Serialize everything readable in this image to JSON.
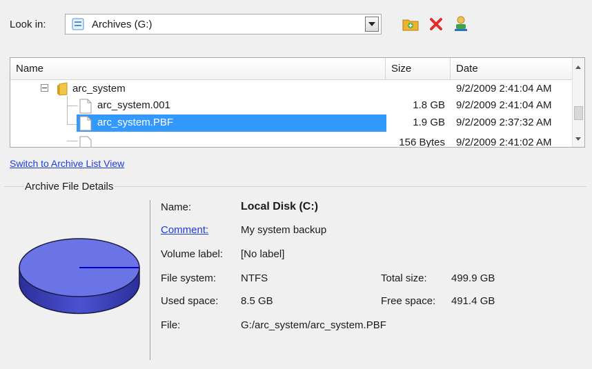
{
  "toolbar": {
    "look_in_label": "Look in:",
    "look_in_value": "Archives (G:)",
    "buttons": [
      "new-folder",
      "delete",
      "user"
    ]
  },
  "file_tree": {
    "columns": [
      "Name",
      "Size",
      "Date"
    ],
    "rows": [
      {
        "name": "arc_system",
        "size": "",
        "date": "9/2/2009 2:41:04 AM",
        "type": "folder",
        "expanded": true
      },
      {
        "name": "arc_system.001",
        "size": "1.8 GB",
        "date": "9/2/2009 2:41:04 AM",
        "type": "file"
      },
      {
        "name": "arc_system.PBF",
        "size": "1.9 GB",
        "date": "9/2/2009 2:37:32 AM",
        "type": "file",
        "selected": true
      }
    ],
    "partial_row": {
      "size": "156 Bytes",
      "date": "9/2/2009 2:41:02 AM"
    }
  },
  "switch_link": "Switch to Archive List View",
  "details": {
    "legend": "Archive File Details",
    "name_label": "Name:",
    "name_value": "Local Disk (C:)",
    "comment_label": "Comment:",
    "comment_value": "My system backup",
    "volume_label_label": "Volume label:",
    "volume_label_value": "[No label]",
    "file_system_label": "File system:",
    "file_system_value": "NTFS",
    "total_size_label": "Total size:",
    "total_size_value": "499.9 GB",
    "used_space_label": "Used space:",
    "used_space_value": "8.5 GB",
    "free_space_label": "Free space:",
    "free_space_value": "491.4 GB",
    "file_label": "File:",
    "file_value": "G:/arc_system/arc_system.PBF",
    "disk_used_fraction": 0.017
  },
  "colors": {
    "selection": "#3399ff",
    "link": "#1f3bd6",
    "disk_fill": "#6a74e6",
    "disk_used": "#0000cc"
  }
}
